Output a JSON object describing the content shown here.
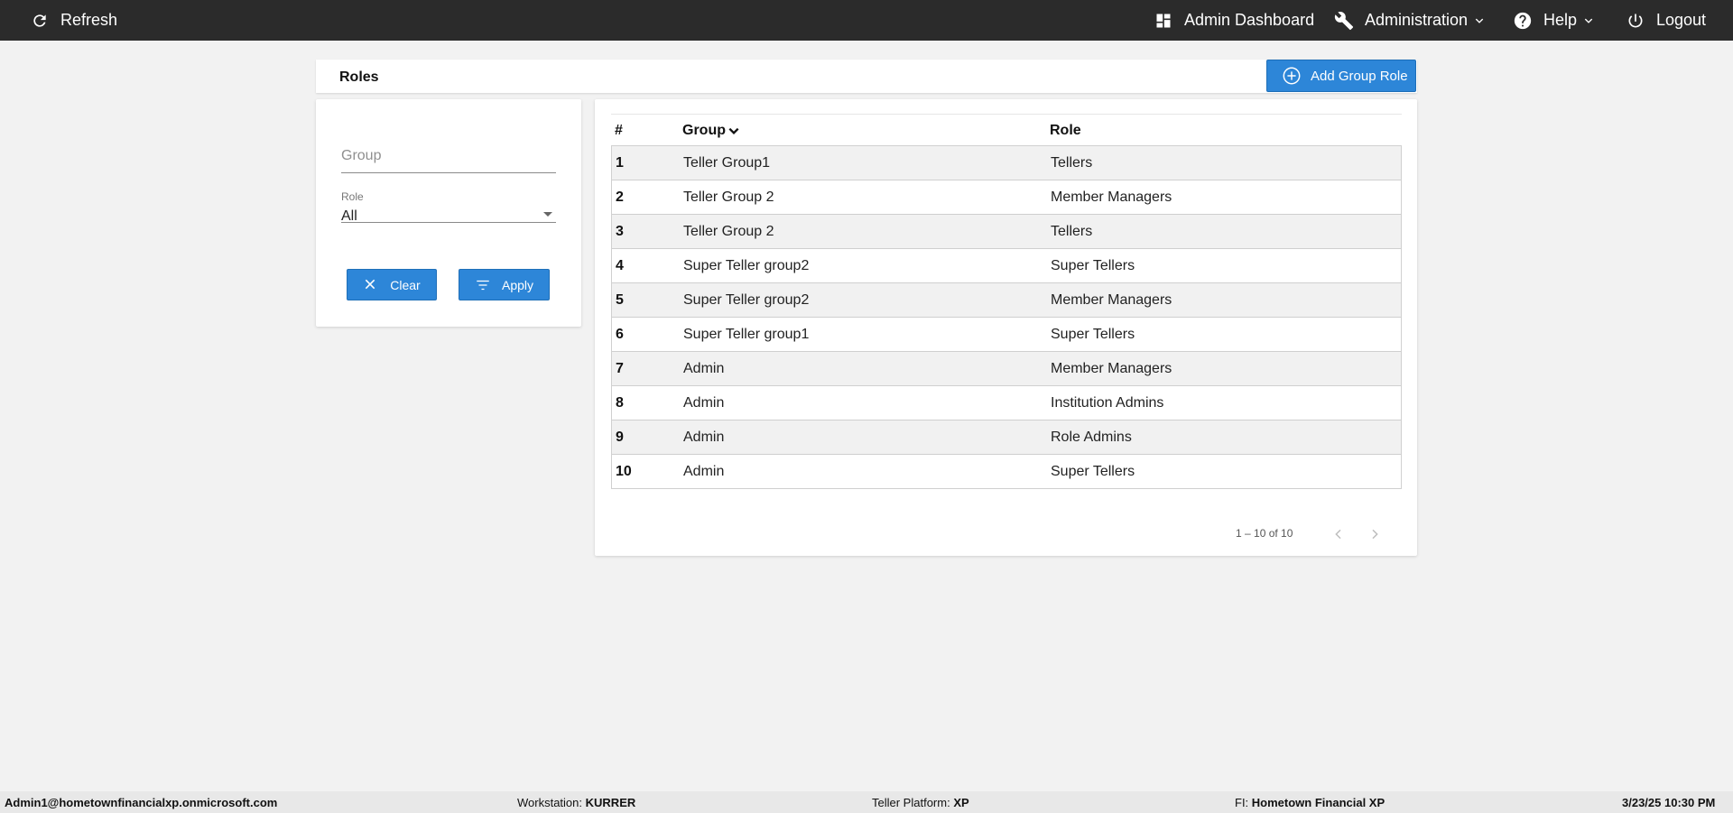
{
  "topbar": {
    "refresh_label": "Refresh",
    "admin_dashboard_label": "Admin Dashboard",
    "administration_label": "Administration",
    "help_label": "Help",
    "logout_label": "Logout"
  },
  "page": {
    "title": "Roles",
    "add_button_label": "Add Group Role"
  },
  "filter": {
    "group_placeholder": "Group",
    "group_value": "",
    "role_label": "Role",
    "role_value": "All",
    "clear_label": "Clear",
    "apply_label": "Apply"
  },
  "table": {
    "headers": {
      "num": "#",
      "group": "Group",
      "role": "Role"
    },
    "rows": [
      {
        "num": "1",
        "group": "Teller Group1",
        "role": "Tellers"
      },
      {
        "num": "2",
        "group": "Teller Group 2",
        "role": "Member Managers"
      },
      {
        "num": "3",
        "group": "Teller Group 2",
        "role": "Tellers"
      },
      {
        "num": "4",
        "group": "Super Teller group2",
        "role": "Super Tellers"
      },
      {
        "num": "5",
        "group": "Super Teller group2",
        "role": "Member Managers"
      },
      {
        "num": "6",
        "group": "Super Teller group1",
        "role": "Super Tellers"
      },
      {
        "num": "7",
        "group": "Admin",
        "role": "Member Managers"
      },
      {
        "num": "8",
        "group": "Admin",
        "role": "Institution Admins"
      },
      {
        "num": "9",
        "group": "Admin",
        "role": "Role Admins"
      },
      {
        "num": "10",
        "group": "Admin",
        "role": "Super Tellers"
      }
    ],
    "pagination": "1 – 10 of 10"
  },
  "status": {
    "user": "Admin1@hometownfinancialxp.onmicrosoft.com",
    "workstation_label": "Workstation:",
    "workstation_value": "KURRER",
    "platform_label": "Teller Platform:",
    "platform_value": "XP",
    "fi_label": "FI:",
    "fi_value": "Hometown Financial XP",
    "datetime": "3/23/25 10:30 PM"
  },
  "colors": {
    "topbar_bg": "#2b2b2b",
    "primary_button": "#2d86d8",
    "page_bg": "#f2f2f2"
  },
  "icons": [
    "refresh-icon",
    "dashboard-icon",
    "wrench-icon",
    "help-circle-icon",
    "power-icon",
    "chevron-down-icon",
    "add-circle-icon",
    "close-icon",
    "filter-icon",
    "chevron-left-icon",
    "chevron-right-icon"
  ]
}
